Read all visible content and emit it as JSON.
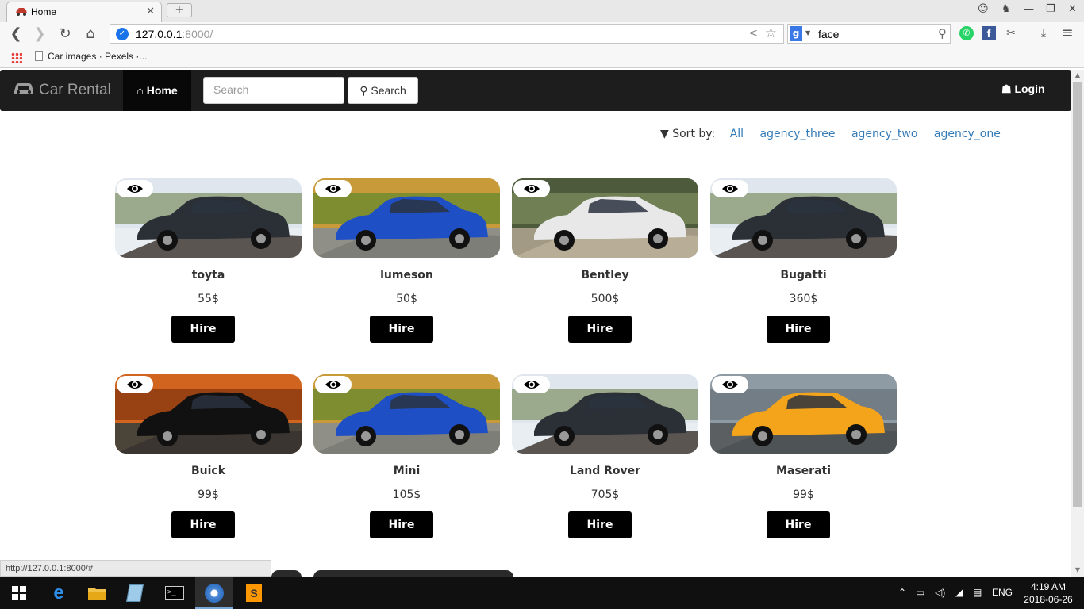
{
  "browser": {
    "tab_title": "Home",
    "url_host": "127.0.0.1",
    "url_rest": ":8000/",
    "search_engine_query": "face",
    "bookmark": "Car images · Pexels ·...",
    "status_url": "http://127.0.0.1:8000/#"
  },
  "navbar": {
    "brand": "Car Rental",
    "home": "Home",
    "search_placeholder": "Search",
    "search_button": "Search",
    "login": "Login"
  },
  "sort": {
    "label": "Sort by:",
    "options": [
      "All",
      "agency_three",
      "agency_two",
      "agency_one"
    ]
  },
  "hire_label": "Hire",
  "cars": [
    {
      "name": "toyta",
      "price": "55$",
      "color": "#2b2f36",
      "scene": "snow"
    },
    {
      "name": "lumeson",
      "price": "50$",
      "color": "#1f4fc4",
      "scene": "autumn"
    },
    {
      "name": "Bentley",
      "price": "500$",
      "color": "#e8e8e8",
      "scene": "forest"
    },
    {
      "name": "Bugatti",
      "price": "360$",
      "color": "#2b2f36",
      "scene": "snow"
    },
    {
      "name": "Buick",
      "price": "99$",
      "color": "#111111",
      "scene": "autumn-red"
    },
    {
      "name": "Mini",
      "price": "105$",
      "color": "#1f4fc4",
      "scene": "autumn"
    },
    {
      "name": "Land Rover",
      "price": "705$",
      "color": "#2b2f36",
      "scene": "snow"
    },
    {
      "name": "Maserati",
      "price": "99$",
      "color": "#f3a41a",
      "scene": "street"
    }
  ],
  "taskbar": {
    "language": "ENG",
    "time": "4:19 AM",
    "date": "2018-06-26"
  }
}
